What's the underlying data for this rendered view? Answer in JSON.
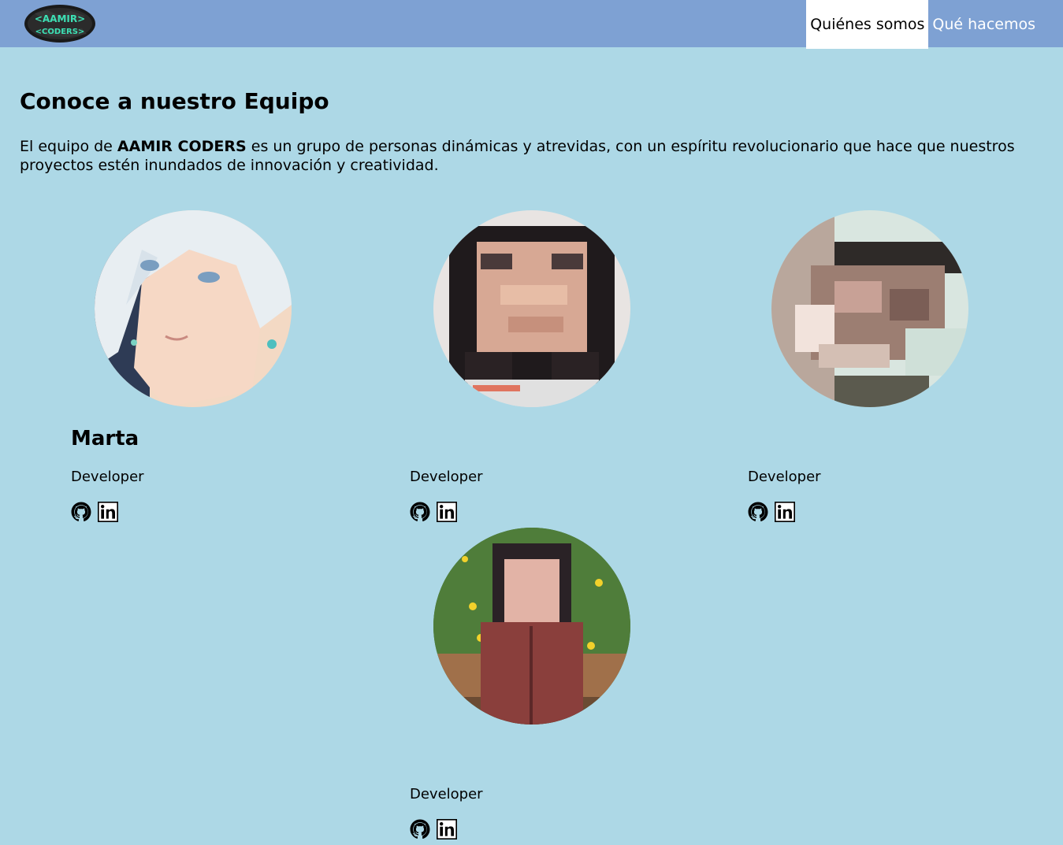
{
  "header": {
    "logo_text_top": "<AAMIR>",
    "logo_text_bottom": "<CODERS>",
    "nav": [
      {
        "label": "Quiénes somos",
        "active": true
      },
      {
        "label": "Qué hacemos",
        "active": false
      }
    ]
  },
  "main": {
    "title": "Conoce a nuestro Equipo",
    "intro_before": "El equipo de ",
    "intro_brand": "AAMIR CODERS",
    "intro_after": " es un grupo de personas dinámicas y atrevidas, con un espíritu revolucionario que hace que nuestros proyectos estén inundados de innovación y creatividad."
  },
  "members": [
    {
      "name": "Marta",
      "role": "Developer",
      "avatar": "anime-illustration-portrait",
      "github_icon": "github-icon",
      "linkedin_icon": "linkedin-icon"
    },
    {
      "name": "",
      "role": "Developer",
      "avatar": "pixelated-portrait-curly-hair",
      "github_icon": "github-icon",
      "linkedin_icon": "linkedin-icon"
    },
    {
      "name": "",
      "role": "Developer",
      "avatar": "pixelated-portrait-side",
      "github_icon": "github-icon",
      "linkedin_icon": "linkedin-icon"
    },
    {
      "name": "",
      "role": "Developer",
      "avatar": "pixelated-portrait-garden",
      "github_icon": "github-icon",
      "linkedin_icon": "linkedin-icon"
    }
  ],
  "colors": {
    "header_bg": "#7ea1d3",
    "page_bg": "#add8e6",
    "nav_active_bg": "#ffffff",
    "nav_text": "#ffffff"
  }
}
